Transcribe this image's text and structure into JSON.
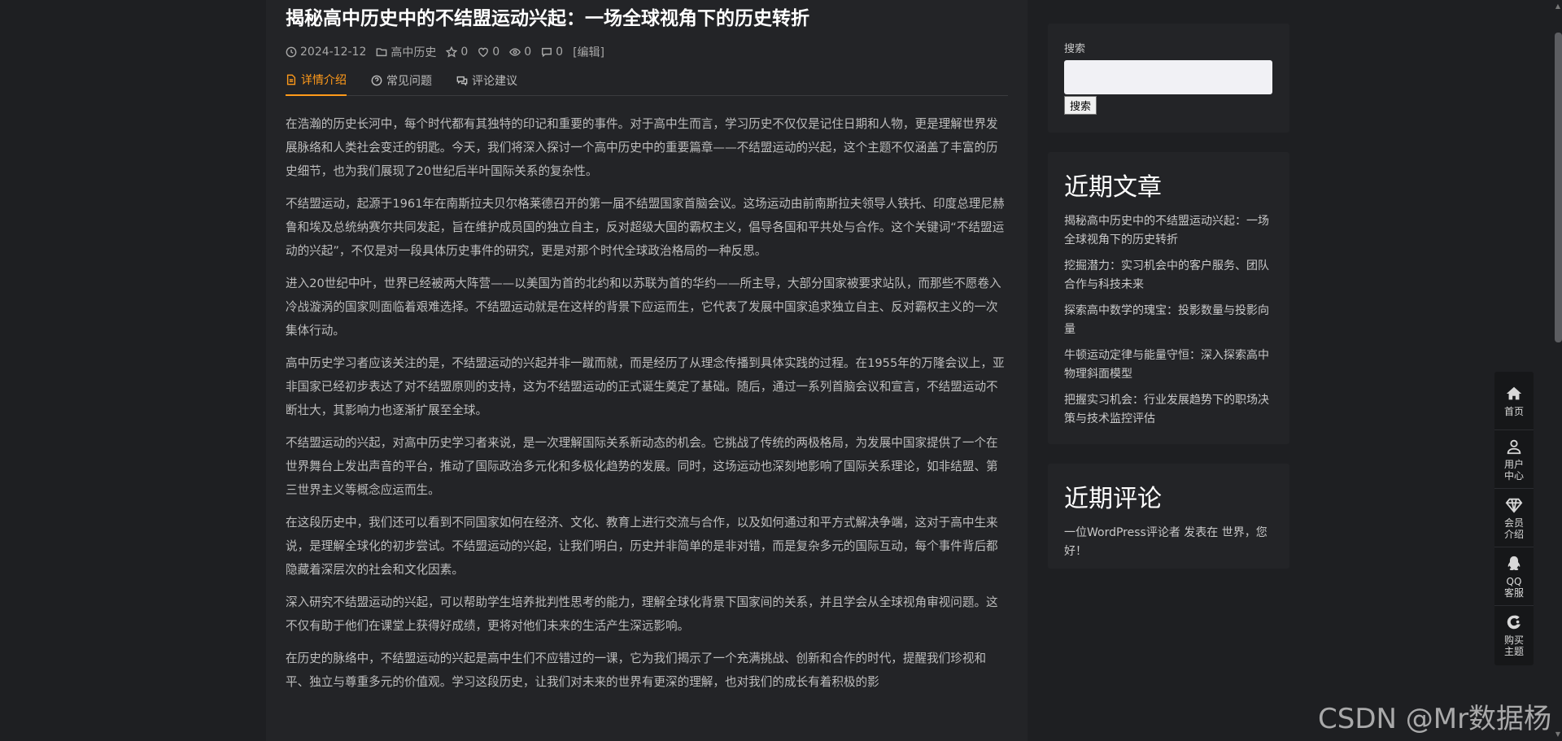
{
  "article": {
    "title": "揭秘高中历史中的不结盟运动兴起：一场全球视角下的历史转折",
    "date": "2024-12-12",
    "category": "高中历史",
    "stars": "0",
    "likes": "0",
    "views": "0",
    "comments": "0",
    "edit": "[编辑]",
    "tabs": [
      {
        "label": "详情介绍"
      },
      {
        "label": "常见问题"
      },
      {
        "label": "评论建议"
      }
    ],
    "paragraphs": [
      "在浩瀚的历史长河中，每个时代都有其独特的印记和重要的事件。对于高中生而言，学习历史不仅仅是记住日期和人物，更是理解世界发展脉络和人类社会变迁的钥匙。今天，我们将深入探讨一个高中历史中的重要篇章——不结盟运动的兴起，这个主题不仅涵盖了丰富的历史细节，也为我们展现了20世纪后半叶国际关系的复杂性。",
      "不结盟运动，起源于1961年在南斯拉夫贝尔格莱德召开的第一届不结盟国家首脑会议。这场运动由前南斯拉夫领导人铁托、印度总理尼赫鲁和埃及总统纳赛尔共同发起，旨在维护成员国的独立自主，反对超级大国的霸权主义，倡导各国和平共处与合作。这个关键词“不结盟运动的兴起”，不仅是对一段具体历史事件的研究，更是对那个时代全球政治格局的一种反思。",
      "进入20世纪中叶，世界已经被两大阵营——以美国为首的北约和以苏联为首的华约——所主导，大部分国家被要求站队，而那些不愿卷入冷战漩涡的国家则面临着艰难选择。不结盟运动就是在这样的背景下应运而生，它代表了发展中国家追求独立自主、反对霸权主义的一次集体行动。",
      "高中历史学习者应该关注的是，不结盟运动的兴起并非一蹴而就，而是经历了从理念传播到具体实践的过程。在1955年的万隆会议上，亚非国家已经初步表达了对不结盟原则的支持，这为不结盟运动的正式诞生奠定了基础。随后，通过一系列首脑会议和宣言，不结盟运动不断壮大，其影响力也逐渐扩展至全球。",
      "不结盟运动的兴起，对高中历史学习者来说，是一次理解国际关系新动态的机会。它挑战了传统的两极格局，为发展中国家提供了一个在世界舞台上发出声音的平台，推动了国际政治多元化和多极化趋势的发展。同时，这场运动也深刻地影响了国际关系理论，如非结盟、第三世界主义等概念应运而生。",
      "在这段历史中，我们还可以看到不同国家如何在经济、文化、教育上进行交流与合作，以及如何通过和平方式解决争端，这对于高中生来说，是理解全球化的初步尝试。不结盟运动的兴起，让我们明白，历史并非简单的是非对错，而是复杂多元的国际互动，每个事件背后都隐藏着深层次的社会和文化因素。",
      "深入研究不结盟运动的兴起，可以帮助学生培养批判性思考的能力，理解全球化背景下国家间的关系，并且学会从全球视角审视问题。这不仅有助于他们在课堂上获得好成绩，更将对他们未来的生活产生深远影响。",
      "在历史的脉络中，不结盟运动的兴起是高中生们不应错过的一课，它为我们揭示了一个充满挑战、创新和合作的时代，提醒我们珍视和平、独立与尊重多元的价值观。学习这段历史，让我们对未来的世界有更深的理解，也对我们的成长有着积极的影"
    ]
  },
  "sidebar": {
    "search": {
      "label": "搜索",
      "button": "搜索"
    },
    "recent_posts": {
      "title": "近期文章",
      "items": [
        "揭秘高中历史中的不结盟运动兴起：一场全球视角下的历史转折",
        "挖掘潜力：实习机会中的客户服务、团队合作与科技未来",
        "探索高中数学的瑰宝：投影数量与投影向量",
        "牛顿运动定律与能量守恒：深入探索高中物理斜面模型",
        "把握实习机会：行业发展趋势下的职场决策与技术监控评估"
      ]
    },
    "recent_comments": {
      "title": "近期评论",
      "text": "一位WordPress评论者 发表在 世界，您好！"
    }
  },
  "float_menu": [
    {
      "label": "首页",
      "icon": "home-icon"
    },
    {
      "label": "用户中心",
      "icon": "user-icon"
    },
    {
      "label": "会员介绍",
      "icon": "diamond-icon"
    },
    {
      "label": "QQ客服",
      "icon": "qq-icon"
    },
    {
      "label": "购买主题",
      "icon": "theme-icon"
    }
  ],
  "watermark": "CSDN @Mr数据杨"
}
